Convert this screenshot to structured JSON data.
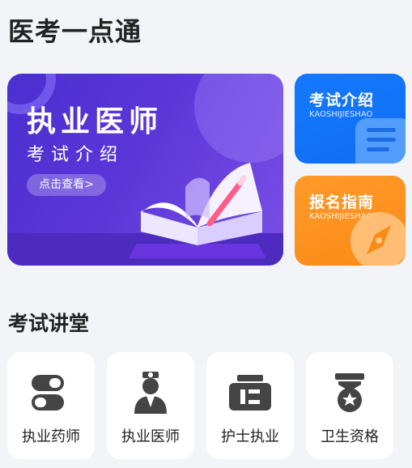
{
  "app": {
    "title": "医考一点通"
  },
  "banner": {
    "title": "执业医师",
    "subtitle": "考试介绍",
    "cta": "点击查看>"
  },
  "cards": [
    {
      "title": "考试介绍",
      "subtitle": "KAOSHIJIESHAO",
      "color": "#1479ff",
      "icon": "list-icon"
    },
    {
      "title": "报名指南",
      "subtitle": "KAOSHIJIESHAO",
      "color": "#fb8a16",
      "icon": "compass-icon"
    }
  ],
  "section": {
    "title": "考试讲堂"
  },
  "tiles": [
    {
      "label": "执业药师",
      "icon": "pill-icon"
    },
    {
      "label": "执业医师",
      "icon": "doctor-icon"
    },
    {
      "label": "护士执业",
      "icon": "nurse-cap-icon"
    },
    {
      "label": "卫生资格",
      "icon": "medal-icon"
    }
  ]
}
